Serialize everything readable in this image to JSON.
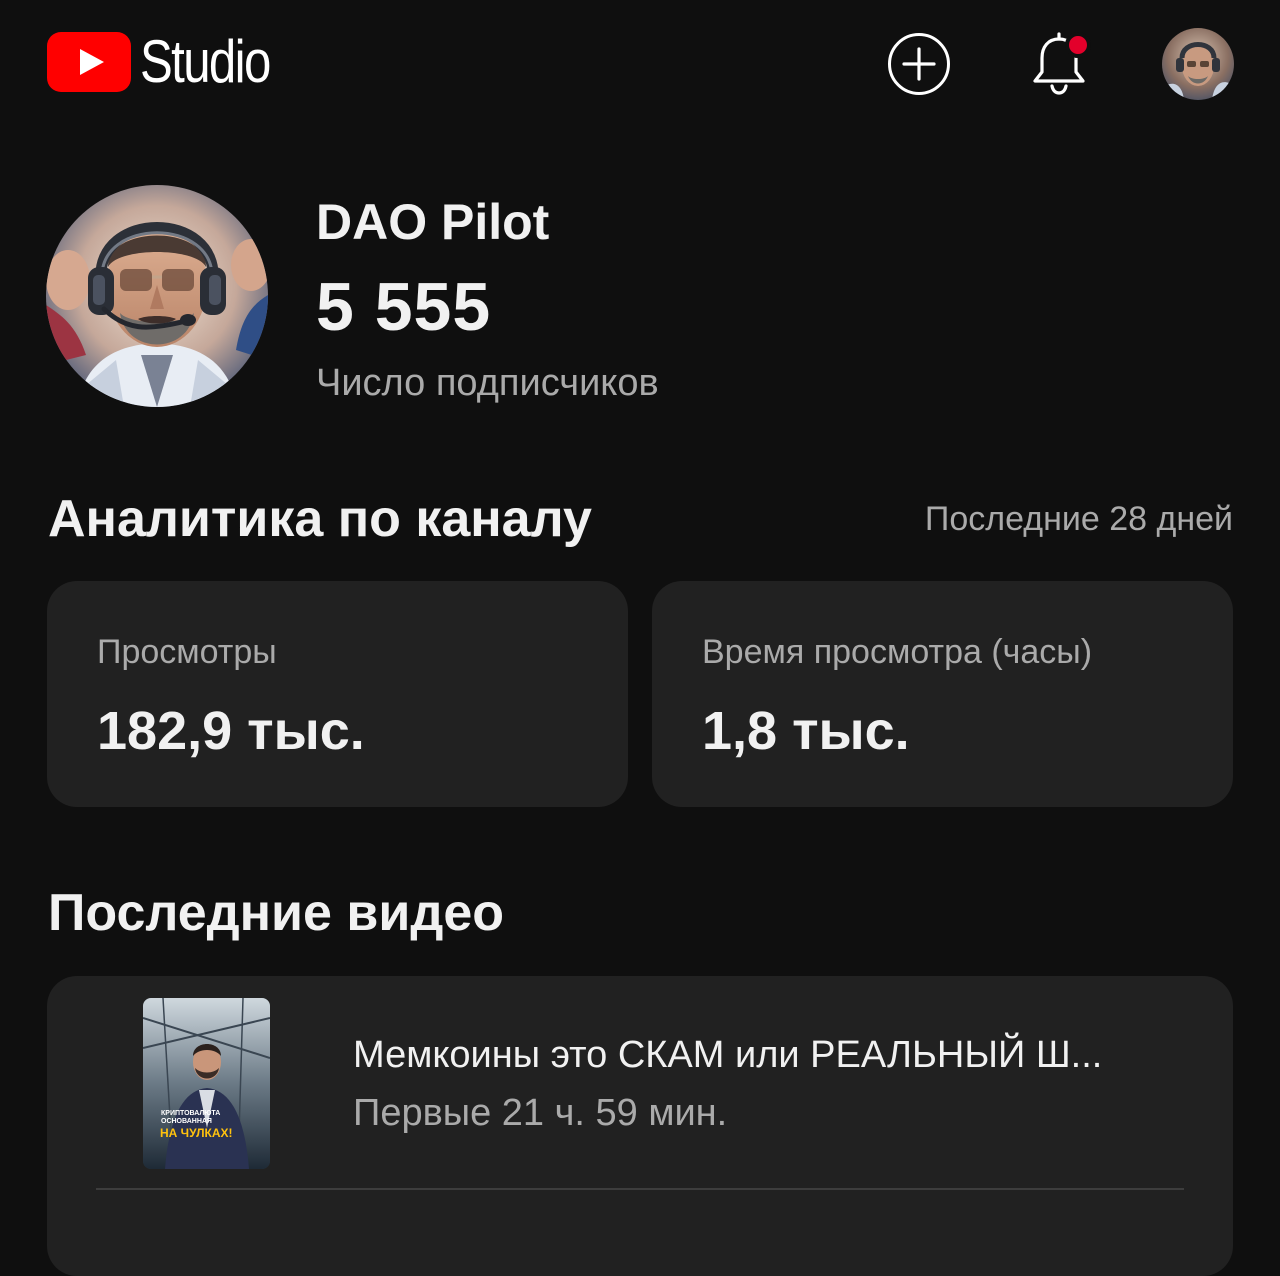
{
  "header": {
    "logo_text": "Studio",
    "brand_color": "#ff0000",
    "create_icon": "plus-circle-icon",
    "notifications_icon": "bell-icon",
    "notification_dot_color": "#e3002b"
  },
  "channel": {
    "name": "DAO Pilot",
    "subscribers": "5 555",
    "subscribers_label": "Число подписчиков"
  },
  "analytics": {
    "title": "Аналитика по каналу",
    "period": "Последние 28 дней",
    "cards": [
      {
        "label": "Просмотры",
        "value": "182,9 тыс."
      },
      {
        "label": "Время просмотра (часы)",
        "value": "1,8 тыс."
      }
    ]
  },
  "latest_videos": {
    "title": "Последние видео",
    "items": [
      {
        "title": "Мемкоины это СКАМ или РЕАЛЬНЫЙ Ш...",
        "meta": "Первые 21 ч. 59 мин.",
        "thumbnail_caption": "Криптовалюта основанная",
        "thumbnail_caption_highlight": "НА ЧУЛКАХ!"
      }
    ]
  }
}
